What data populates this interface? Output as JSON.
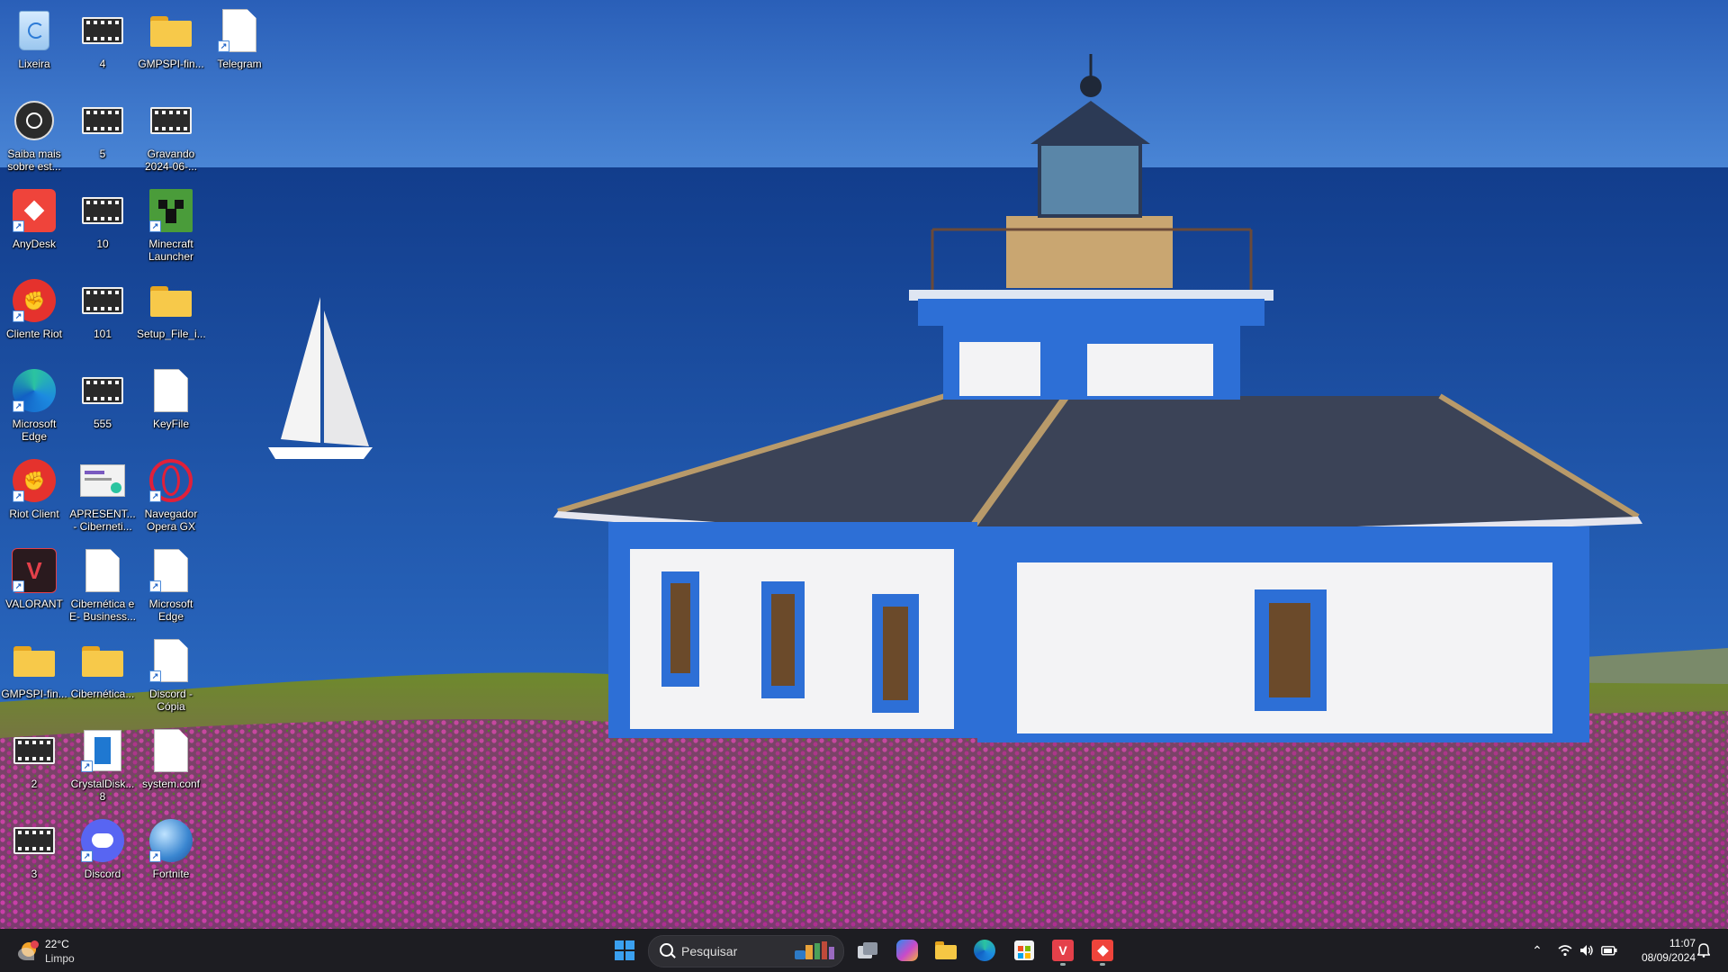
{
  "desktop": {
    "icons": [
      {
        "label": "Lixeira",
        "icon": "recycle-bin-icon",
        "type": "recycle",
        "col": 0,
        "row": 0
      },
      {
        "label": "4",
        "icon": "video-file-icon",
        "type": "film",
        "col": 1,
        "row": 0
      },
      {
        "label": "GMPSPI-fin...",
        "icon": "zip-folder-icon",
        "type": "folder",
        "col": 2,
        "row": 0
      },
      {
        "label": "Telegram",
        "icon": "file-icon",
        "type": "doc",
        "col": 3,
        "row": 0,
        "shortcut": true
      },
      {
        "label": "Saiba mais\nsobre est...",
        "icon": "camera-icon",
        "type": "saiba",
        "col": 0,
        "row": 1
      },
      {
        "label": "5",
        "icon": "video-file-icon",
        "type": "film",
        "col": 1,
        "row": 1
      },
      {
        "label": "Gravando\n2024-06-...",
        "icon": "video-file-icon",
        "type": "film",
        "col": 2,
        "row": 1
      },
      {
        "label": "AnyDesk",
        "icon": "anydesk-icon",
        "type": "anydesk",
        "col": 0,
        "row": 2,
        "shortcut": true
      },
      {
        "label": "10",
        "icon": "video-file-icon",
        "type": "film",
        "col": 1,
        "row": 2
      },
      {
        "label": "Minecraft\nLauncher",
        "icon": "minecraft-icon",
        "type": "minecraft",
        "col": 2,
        "row": 2,
        "shortcut": true
      },
      {
        "label": "Cliente Riot",
        "icon": "riot-icon",
        "type": "riot",
        "col": 0,
        "row": 3,
        "shortcut": true
      },
      {
        "label": "101",
        "icon": "video-file-icon",
        "type": "film",
        "col": 1,
        "row": 3
      },
      {
        "label": "Setup_File_i...",
        "icon": "folder-icon",
        "type": "folder",
        "col": 2,
        "row": 3
      },
      {
        "label": "Microsoft\nEdge",
        "icon": "edge-icon",
        "type": "edge",
        "col": 0,
        "row": 4,
        "shortcut": true
      },
      {
        "label": "555",
        "icon": "video-file-icon",
        "type": "film",
        "col": 1,
        "row": 4
      },
      {
        "label": "KeyFile",
        "icon": "text-file-icon",
        "type": "doc",
        "col": 2,
        "row": 4
      },
      {
        "label": "Riot Client",
        "icon": "riot-icon",
        "type": "riot",
        "col": 0,
        "row": 5,
        "shortcut": true
      },
      {
        "label": "APRESENT...\n- Ciberneti...",
        "icon": "presentation-file-icon",
        "type": "pres",
        "col": 1,
        "row": 5
      },
      {
        "label": "Navegador\nOpera GX",
        "icon": "opera-gx-icon",
        "type": "opera",
        "col": 2,
        "row": 5,
        "shortcut": true
      },
      {
        "label": "VALORANT",
        "icon": "valorant-icon",
        "type": "valorant",
        "col": 0,
        "row": 6,
        "shortcut": true
      },
      {
        "label": "Cibernética e\nE- Business...",
        "icon": "document-file-icon",
        "type": "doc",
        "col": 1,
        "row": 6
      },
      {
        "label": "Microsoft\nEdge",
        "icon": "file-icon",
        "type": "doc",
        "col": 2,
        "row": 6,
        "shortcut": true
      },
      {
        "label": "GMPSPI-fin...",
        "icon": "folder-icon",
        "type": "folder",
        "col": 0,
        "row": 7
      },
      {
        "label": "Cibernética...",
        "icon": "zip-folder-icon",
        "type": "folder",
        "col": 1,
        "row": 7
      },
      {
        "label": "Discord -\nCópia",
        "icon": "file-icon",
        "type": "doc",
        "col": 2,
        "row": 7,
        "shortcut": true
      },
      {
        "label": "2",
        "icon": "video-file-icon",
        "type": "film",
        "col": 0,
        "row": 8
      },
      {
        "label": "CrystalDisk...\n8",
        "icon": "crystaldisk-icon",
        "type": "crystal",
        "col": 1,
        "row": 8,
        "shortcut": true
      },
      {
        "label": "system.conf",
        "icon": "file-icon",
        "type": "doc",
        "col": 2,
        "row": 8
      },
      {
        "label": "3",
        "icon": "video-file-icon",
        "type": "film",
        "col": 0,
        "row": 9
      },
      {
        "label": "Discord",
        "icon": "discord-icon",
        "type": "discord",
        "col": 1,
        "row": 9,
        "shortcut": true
      },
      {
        "label": "Fortnite",
        "icon": "globe-icon",
        "type": "fortnite",
        "col": 2,
        "row": 9,
        "shortcut": true
      }
    ]
  },
  "taskbar": {
    "weather": {
      "temp": "22°C",
      "condition": "Limpo",
      "icon": "weather-sun-icon"
    },
    "search": {
      "placeholder": "Pesquisar"
    },
    "apps": [
      {
        "name": "start-button",
        "icon": "windows-logo-icon"
      },
      {
        "name": "task-view-button",
        "icon": "task-view-icon"
      },
      {
        "name": "copilot-button",
        "icon": "copilot-icon"
      },
      {
        "name": "file-explorer-button",
        "icon": "folder-icon"
      },
      {
        "name": "edge-button",
        "icon": "edge-icon"
      },
      {
        "name": "store-button",
        "icon": "store-icon"
      },
      {
        "name": "valorant-button",
        "icon": "valorant-icon",
        "running": true
      },
      {
        "name": "anydesk-button",
        "icon": "anydesk-icon",
        "running": true
      }
    ],
    "clock": {
      "time": "11:07",
      "date": "08/09/2024"
    },
    "tray": [
      "chevron-up-icon",
      "wifi-icon",
      "volume-icon",
      "battery-icon",
      "notification-icon"
    ]
  },
  "colors": {
    "taskbar": "#1d1d22",
    "sky": "#2f6bc4",
    "sea": "#1a4a9a",
    "flowers": "#b0338e"
  }
}
